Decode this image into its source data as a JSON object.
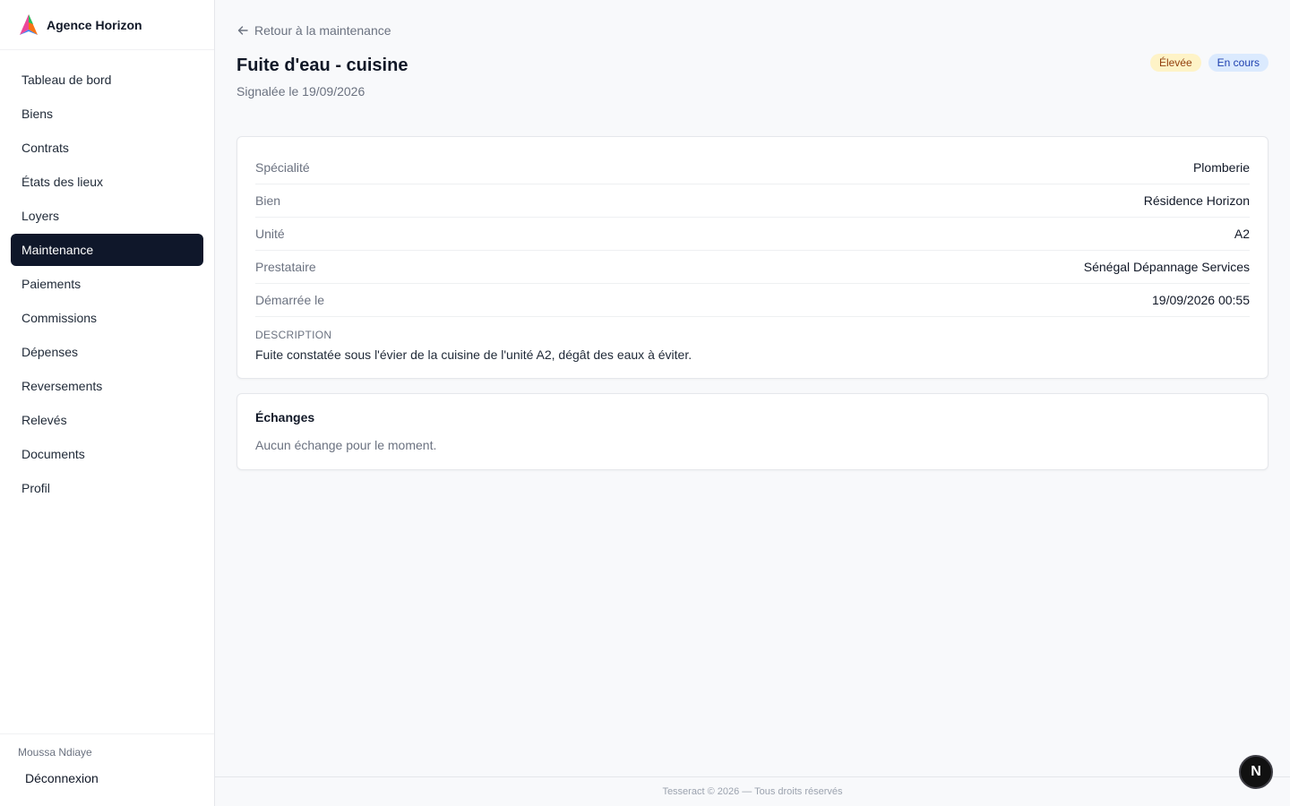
{
  "brand": {
    "name": "Agence Horizon",
    "logo_icon": "triangle-logo-icon"
  },
  "sidebar": {
    "items": [
      {
        "label": "Tableau de bord"
      },
      {
        "label": "Biens"
      },
      {
        "label": "Contrats"
      },
      {
        "label": "États des lieux"
      },
      {
        "label": "Loyers"
      },
      {
        "label": "Maintenance",
        "active": true
      },
      {
        "label": "Paiements"
      },
      {
        "label": "Commissions"
      },
      {
        "label": "Dépenses"
      },
      {
        "label": "Reversements"
      },
      {
        "label": "Relevés"
      },
      {
        "label": "Documents"
      },
      {
        "label": "Profil"
      }
    ],
    "user_name": "Moussa Ndiaye",
    "logout_label": "Déconnexion"
  },
  "header": {
    "back_label": "Retour à la maintenance",
    "title": "Fuite d'eau - cuisine",
    "subtitle": "Signalée le 19/09/2026",
    "badges": {
      "priority": "Élevée",
      "status": "En cours"
    }
  },
  "details": {
    "rows": [
      {
        "label": "Spécialité",
        "value": "Plomberie"
      },
      {
        "label": "Bien",
        "value": "Résidence Horizon"
      },
      {
        "label": "Unité",
        "value": "A2"
      },
      {
        "label": "Prestataire",
        "value": "Sénégal Dépannage Services"
      },
      {
        "label": "Démarrée le",
        "value": "19/09/2026 00:55"
      }
    ],
    "description_label": "DESCRIPTION",
    "description_text": "Fuite constatée sous l'évier de la cuisine de l'unité A2, dégât des eaux à éviter."
  },
  "exchanges": {
    "title": "Échanges",
    "empty_text": "Aucun échange pour le moment."
  },
  "footer": {
    "text": "Tesseract © 2026 — Tous droits réservés"
  },
  "fab": {
    "label": "N"
  },
  "colors": {
    "accent": "#0f172a",
    "priority_bg": "#fef3c7",
    "status_bg": "#dbeafe"
  }
}
